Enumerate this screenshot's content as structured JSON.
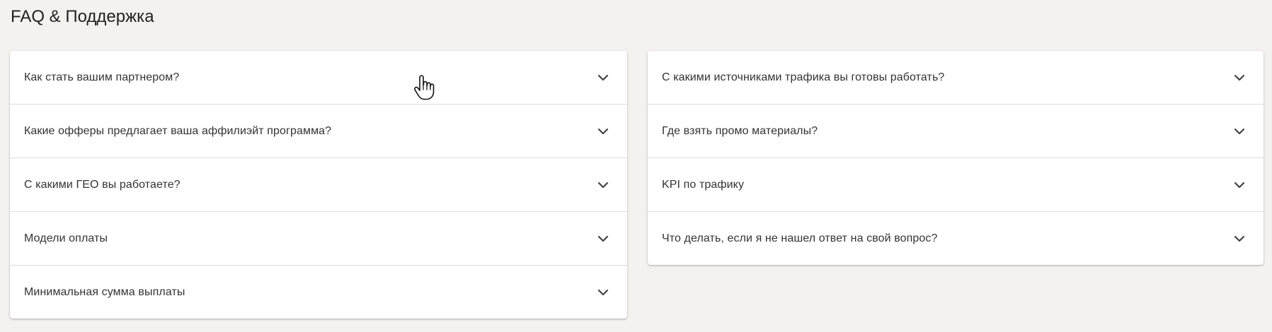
{
  "page": {
    "title": "FAQ & Поддержка"
  },
  "faq": {
    "left": [
      {
        "question": "Как стать вашим партнером?"
      },
      {
        "question": "Какие офферы предлагает ваша аффилиэйт программа?"
      },
      {
        "question": "С какими ГЕО вы работаете?"
      },
      {
        "question": "Модели оплаты"
      },
      {
        "question": "Минимальная сумма выплаты"
      }
    ],
    "right": [
      {
        "question": "С какими источниками трафика вы готовы работать?"
      },
      {
        "question": "Где взять промо материалы?"
      },
      {
        "question": "KPI по трафику"
      },
      {
        "question": "Что делать, если я не нашел ответ на свой вопрос?"
      }
    ]
  },
  "icons": {
    "expand": "chevron-down-icon",
    "cursor": "hand-pointer-cursor"
  },
  "colors": {
    "background": "#f3f2ef",
    "card": "#ffffff",
    "text": "#333333",
    "divider": "#dcdcdc"
  }
}
